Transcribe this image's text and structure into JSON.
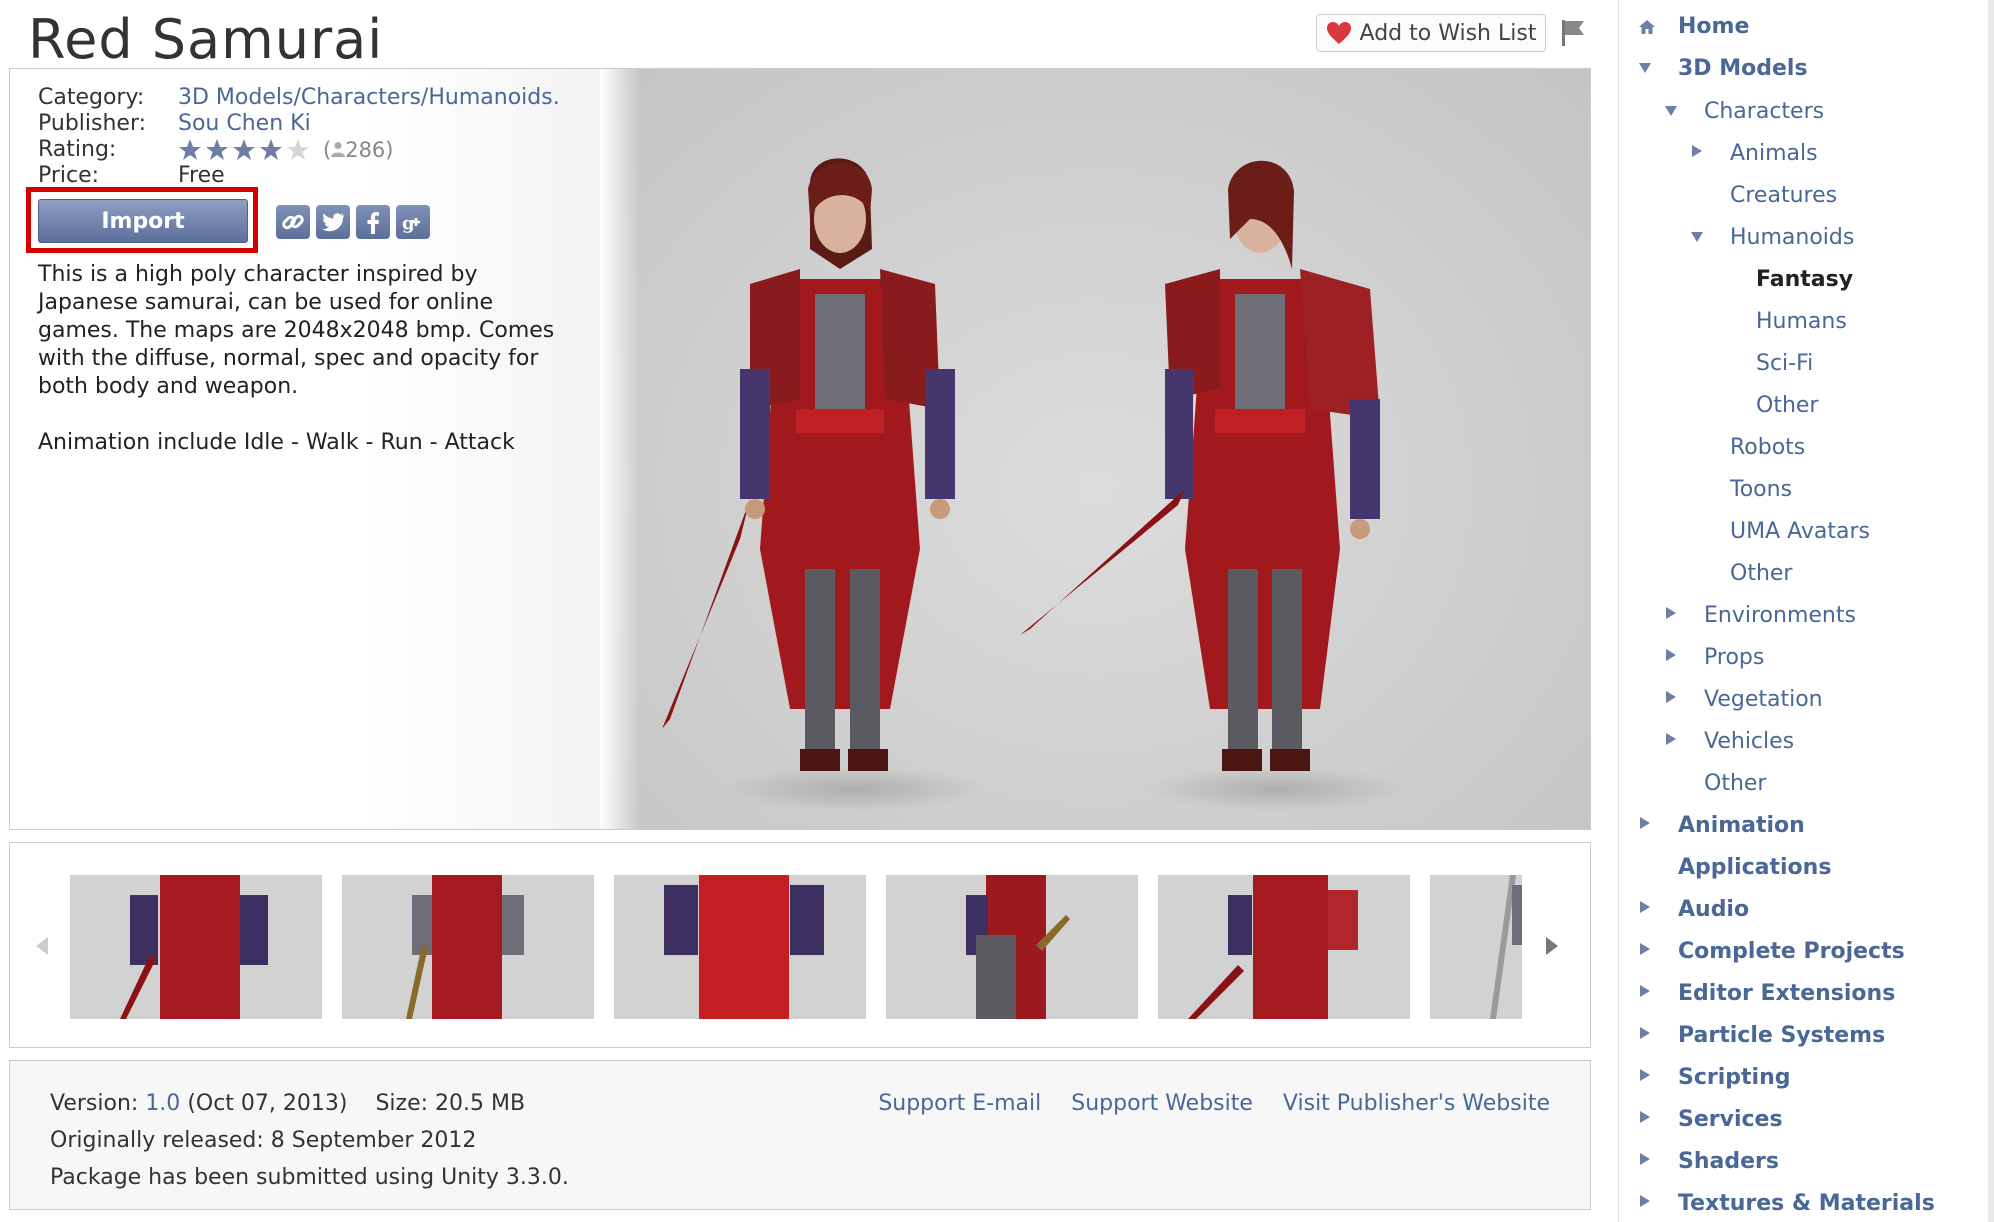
{
  "product": {
    "title": "Red Samurai",
    "wish_list_label": "Add to Wish List",
    "meta": {
      "category_label": "Category:",
      "category_value": "3D Models/Characters/Humanoids.",
      "publisher_label": "Publisher:",
      "publisher_value": "Sou Chen Ki",
      "rating_label": "Rating:",
      "rating_stars": 4,
      "rating_max": 5,
      "rating_count": "286",
      "price_label": "Price:",
      "price_value": "Free"
    },
    "import_label": "Import",
    "share_icons": [
      "link-icon",
      "twitter-icon",
      "facebook-icon",
      "google-plus-icon"
    ],
    "description": [
      "This is a high poly character inspired by Japanese samurai, can be used for online games. The maps are 2048x2048 bmp. Comes with the diffuse, normal, spec and opacity for both body and weapon.",
      "Animation include Idle - Walk - Run - Attack"
    ]
  },
  "footer": {
    "version_label": "Version:",
    "version_value": "1.0",
    "version_date": "(Oct 07, 2013)",
    "size_label": "Size:",
    "size_value": "20.5 MB",
    "released": "Originally released: 8 September 2012",
    "submitted": "Package has been submitted using Unity 3.3.0.",
    "links": [
      "Support E-mail",
      "Support Website",
      "Visit Publisher's Website"
    ]
  },
  "sidebar": {
    "home": "Home",
    "models": "3D Models",
    "characters": "Characters",
    "animals": "Animals",
    "creatures": "Creatures",
    "humanoids": "Humanoids",
    "fantasy": "Fantasy",
    "humans": "Humans",
    "scifi": "Sci-Fi",
    "hum_other": "Other",
    "robots": "Robots",
    "toons": "Toons",
    "uma": "UMA Avatars",
    "char_other": "Other",
    "environments": "Environments",
    "props": "Props",
    "vegetation": "Vegetation",
    "vehicles": "Vehicles",
    "models_other": "Other",
    "animation": "Animation",
    "applications": "Applications",
    "audio": "Audio",
    "complete": "Complete Projects",
    "editor": "Editor Extensions",
    "particle": "Particle Systems",
    "scripting": "Scripting",
    "services": "Services",
    "shaders": "Shaders",
    "textures": "Textures & Materials"
  },
  "colors": {
    "link": "#4a6796",
    "import_highlight": "#d40000",
    "heart": "#d9383d"
  }
}
